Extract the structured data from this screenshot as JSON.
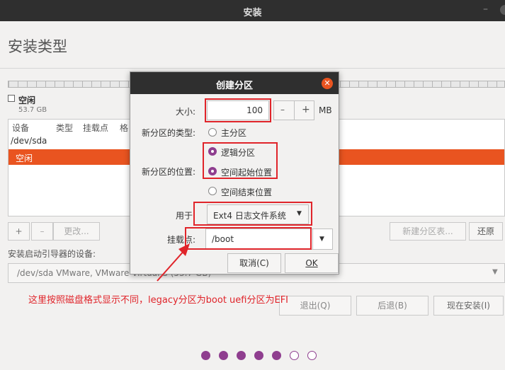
{
  "window": {
    "title": "安装",
    "minimize_glyph": "–"
  },
  "page": {
    "title": "安装类型"
  },
  "legend": {
    "name": "空闲",
    "size": "53.7 GB"
  },
  "table": {
    "headers": [
      "设备",
      "类型",
      "挂载点",
      "格"
    ],
    "device": "/dev/sda",
    "selected_row": "空闲"
  },
  "table_buttons": {
    "add": "+",
    "remove": "–",
    "change": "更改...",
    "new_table": "新建分区表...",
    "revert": "还原"
  },
  "bootloader": {
    "label": "安装启动引导器的设备:",
    "value": "/dev/sda   VMware, VMware Virtual S (53.7 GB)"
  },
  "nav": {
    "quit": "退出(Q)",
    "back": "后退(B)",
    "install_now": "现在安装(I)"
  },
  "progress": {
    "total": 7,
    "completed": 5
  },
  "dialog": {
    "title": "创建分区",
    "size_label": "大小:",
    "size_value": "100",
    "minus": "–",
    "plus": "+",
    "unit": "MB",
    "type_label": "新分区的类型:",
    "type_primary": "主分区",
    "type_logical": "逻辑分区",
    "location_label": "新分区的位置:",
    "loc_begin": "空间起始位置",
    "loc_end": "空间结束位置",
    "use_label": "用于:",
    "use_value": "Ext4 日志文件系统",
    "mount_label": "挂载点:",
    "mount_value": "/boot",
    "cancel": "取消(C)",
    "ok": "OK",
    "selected_type": "逻辑分区",
    "selected_location": "空间起始位置"
  },
  "annotation": {
    "text": "这里按照磁盘格式显示不同，legacy分区为boot uefi分区为EFI",
    "color": "#e0242a"
  },
  "colors": {
    "accent": "#e95420",
    "progress": "#8f3e8f",
    "titlebar": "#2f2f2f"
  }
}
